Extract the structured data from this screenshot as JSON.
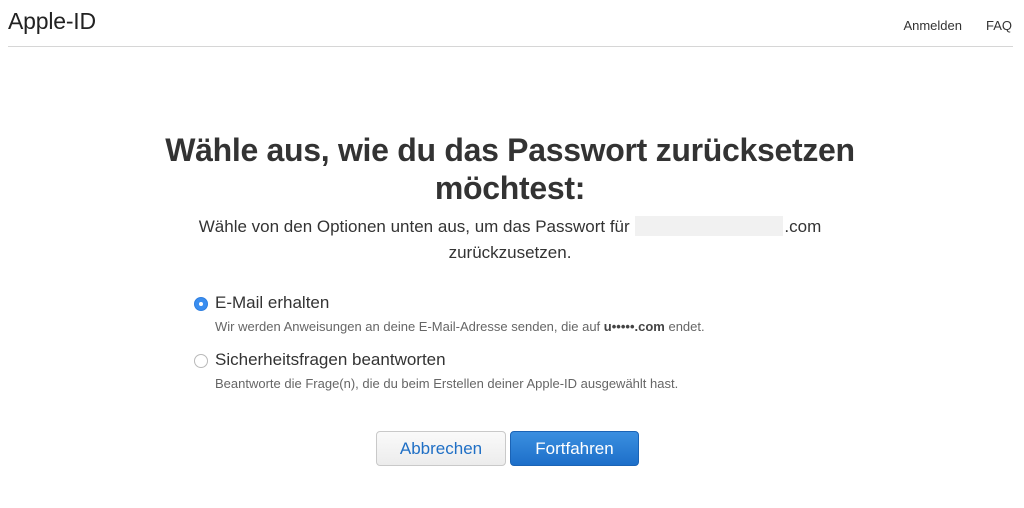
{
  "header": {
    "brand": "Apple-ID",
    "nav": [
      {
        "label": "Anmelden"
      },
      {
        "label": "FAQ"
      }
    ]
  },
  "main": {
    "heading": "Wähle aus, wie du das Passwort zurücksetzen möchtest:",
    "subtitle_prefix": "Wähle von den Optionen unten aus, um das Passwort für",
    "subtitle_email_suffix": ".com",
    "subtitle_line2": "zurückzusetzen.",
    "options": [
      {
        "label": "E-Mail erhalten",
        "desc_prefix": "Wir werden Anweisungen an deine E-Mail-Adresse senden, die auf",
        "desc_bold": "u•••••.com",
        "desc_suffix": "endet.",
        "selected": true
      },
      {
        "label": "Sicherheitsfragen beantworten",
        "desc": "Beantworte die Frage(n), die du beim Erstellen deiner Apple-ID ausgewählt hast.",
        "selected": false
      }
    ],
    "buttons": {
      "cancel": "Abbrechen",
      "continue": "Fortfahren"
    }
  },
  "colors": {
    "accent": "#1d6fc9",
    "link": "#1f6fc5",
    "radio_selected": "#3a8ef0"
  }
}
